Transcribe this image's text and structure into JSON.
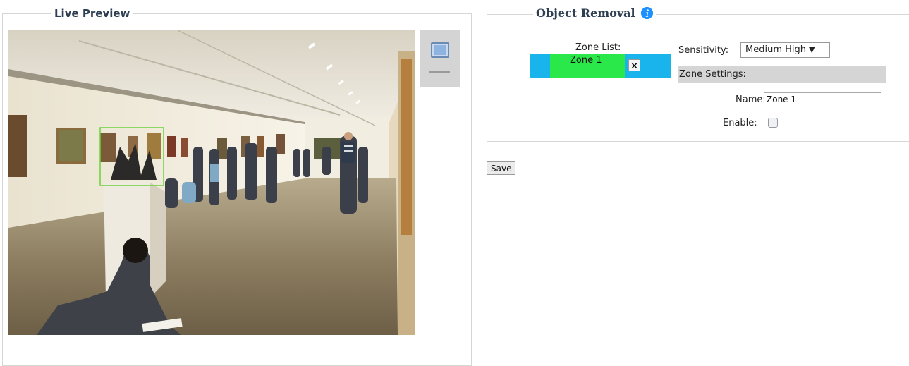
{
  "live_preview": {
    "legend": "Live Preview"
  },
  "object_removal": {
    "legend": "Object Removal",
    "info_icon": "info-icon",
    "zone_list_label": "Zone List:",
    "zones": [
      {
        "label": "Zone 1",
        "delete_symbol": "×"
      }
    ],
    "sensitivity_label": "Sensitivity:",
    "sensitivity_value": "Medium High",
    "sensitivity_arrow": "▼",
    "zone_settings_label": "Zone Settings:",
    "name_label": "Name:",
    "name_value": "Zone 1",
    "enable_label": "Enable:",
    "enable_checked": false
  },
  "save_label": "Save",
  "colors": {
    "zone_list_bg": "#1ab4ec",
    "zone_item_bg": "#2ae84a",
    "detection_box": "#6cd23a",
    "info_icon": "#1e90ff"
  }
}
